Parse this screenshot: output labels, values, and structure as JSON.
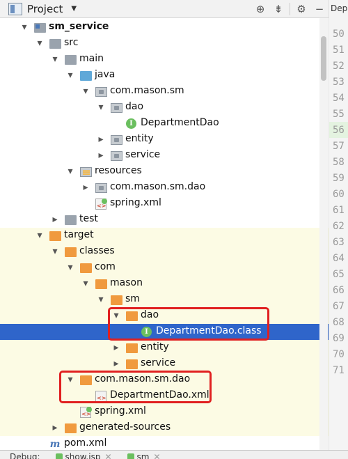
{
  "header": {
    "title": "Project",
    "tools": [
      {
        "icon": "locate-icon",
        "glyph": "⊕"
      },
      {
        "icon": "collapse-all-icon",
        "glyph": "⇟"
      },
      {
        "icon": "gear-icon",
        "glyph": "⚙"
      },
      {
        "icon": "hide-icon",
        "glyph": "−"
      }
    ]
  },
  "tree": {
    "items": [
      {
        "label": "sm_service",
        "depth": 1,
        "expanded": true,
        "icon": "module-folder-icon"
      },
      {
        "label": "src",
        "depth": 2,
        "expanded": true,
        "icon": "folder-icon"
      },
      {
        "label": "main",
        "depth": 3,
        "expanded": true,
        "icon": "folder-icon"
      },
      {
        "label": "java",
        "depth": 4,
        "expanded": true,
        "icon": "source-folder-icon"
      },
      {
        "label": "com.mason.sm",
        "depth": 5,
        "expanded": true,
        "icon": "package-icon"
      },
      {
        "label": "dao",
        "depth": 6,
        "expanded": true,
        "icon": "package-icon"
      },
      {
        "label": "DepartmentDao",
        "depth": 7,
        "icon": "interface-icon"
      },
      {
        "label": "entity",
        "depth": 6,
        "expanded": false,
        "icon": "package-icon"
      },
      {
        "label": "service",
        "depth": 6,
        "expanded": false,
        "icon": "package-icon"
      },
      {
        "label": "resources",
        "depth": 4,
        "expanded": true,
        "icon": "resources-folder-icon"
      },
      {
        "label": "com.mason.sm.dao",
        "depth": 5,
        "expanded": false,
        "icon": "package-icon"
      },
      {
        "label": "spring.xml",
        "depth": 5,
        "icon": "spring-xml-icon"
      },
      {
        "label": "test",
        "depth": 3,
        "expanded": false,
        "icon": "folder-icon"
      },
      {
        "label": "target",
        "depth": 2,
        "expanded": true,
        "icon": "excluded-folder-icon",
        "excluded": true
      },
      {
        "label": "classes",
        "depth": 3,
        "expanded": true,
        "icon": "excluded-folder-icon",
        "excluded": true
      },
      {
        "label": "com",
        "depth": 4,
        "expanded": true,
        "icon": "excluded-folder-icon",
        "excluded": true
      },
      {
        "label": "mason",
        "depth": 5,
        "expanded": true,
        "icon": "excluded-folder-icon",
        "excluded": true
      },
      {
        "label": "sm",
        "depth": 6,
        "expanded": true,
        "icon": "excluded-folder-icon",
        "excluded": true
      },
      {
        "label": "dao",
        "depth": 7,
        "expanded": true,
        "icon": "excluded-folder-icon",
        "excluded": true
      },
      {
        "label": "DepartmentDao.class",
        "depth": 8,
        "icon": "interface-icon",
        "selected": true
      },
      {
        "label": "entity",
        "depth": 7,
        "expanded": false,
        "icon": "excluded-folder-icon",
        "excluded": true
      },
      {
        "label": "service",
        "depth": 7,
        "expanded": false,
        "icon": "excluded-folder-icon",
        "excluded": true
      },
      {
        "label": "com.mason.sm.dao",
        "depth": 4,
        "expanded": true,
        "icon": "excluded-folder-icon",
        "excluded": true
      },
      {
        "label": "DepartmentDao.xml",
        "depth": 5,
        "icon": "xml-file-icon",
        "excluded": true
      },
      {
        "label": "spring.xml",
        "depth": 4,
        "icon": "spring-xml-icon",
        "excluded": true
      },
      {
        "label": "generated-sources",
        "depth": 3,
        "expanded": false,
        "icon": "excluded-folder-icon",
        "excluded": true
      },
      {
        "label": "pom.xml",
        "depth": 2,
        "icon": "maven-pom-icon"
      }
    ]
  },
  "gutter": {
    "tab_label": "Depa",
    "highlighted_line": "56",
    "line_numbers": [
      "50",
      "51",
      "52",
      "53",
      "54",
      "55",
      "56",
      "57",
      "58",
      "59",
      "60",
      "61",
      "62",
      "63",
      "64",
      "65",
      "66",
      "67",
      "68",
      "69",
      "70",
      "71"
    ]
  },
  "debug": {
    "label": "Debug:",
    "tabs": [
      "show.jsp",
      "sm"
    ]
  },
  "colors": {
    "selection": "#2f65ca",
    "excluded_bg": "#fcfbe4",
    "highlight_box": "#e02020",
    "excluded_folder": "#f09a3e",
    "interface_icon": "#6bbf5f"
  }
}
